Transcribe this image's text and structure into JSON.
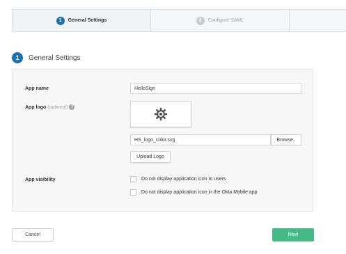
{
  "stepper": {
    "steps": [
      {
        "number": "1",
        "label": "General Settings"
      },
      {
        "number": "2",
        "label": "Configure SAML"
      }
    ]
  },
  "section": {
    "number": "1",
    "title": "General Settings"
  },
  "form": {
    "app_name_label": "App name",
    "app_name_value": "HelloSign",
    "app_logo_label": "App logo",
    "app_logo_optional": "(optional)",
    "help_icon": "?",
    "logo_icon": "gear-icon",
    "file_name": "HS_logo_color.svg",
    "browse_label": "Browse..",
    "upload_label": "Upload Logo",
    "visibility_label": "App visibility",
    "visibility_options": [
      {
        "label": "Do not display application icon to users",
        "checked": false
      },
      {
        "label": "Do not display application icon in the Okta Mobile app",
        "checked": false
      }
    ]
  },
  "footer": {
    "cancel_label": "Cancel",
    "next_label": "Next"
  },
  "colors": {
    "accent": "#1f6fa8",
    "next_button": "#46b987"
  }
}
